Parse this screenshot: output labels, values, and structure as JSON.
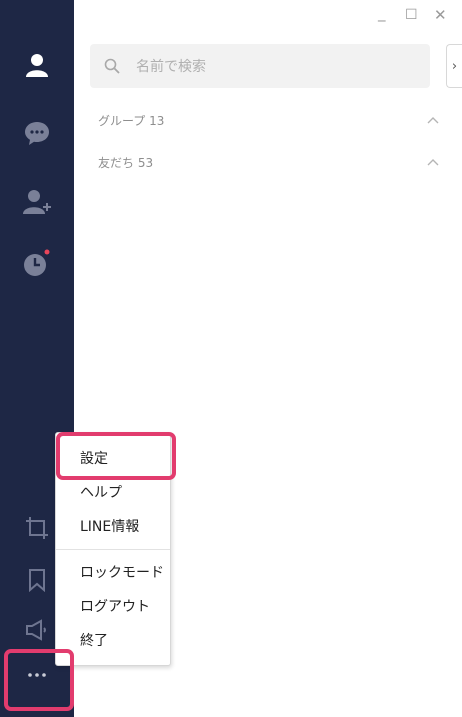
{
  "window": {
    "minimize_label": "_",
    "maximize_label": "☐",
    "close_label": "✕"
  },
  "search": {
    "placeholder": "名前で検索",
    "collapse_icon": "chevron-right"
  },
  "sections": [
    {
      "label": "グループ 13",
      "icon": "chevron-up"
    },
    {
      "label": "友だち 53",
      "icon": "chevron-up"
    }
  ],
  "sidebar": {
    "top_icons": [
      "person-icon",
      "chat-icon",
      "add-friend-icon",
      "clock-icon"
    ],
    "bottom_icons": [
      "crop-icon",
      "bookmark-icon",
      "megaphone-icon",
      "more-icon"
    ],
    "notification_color": "#e8455a"
  },
  "menu": {
    "items": [
      "設定",
      "ヘルプ",
      "LINE情報",
      "ロックモード",
      "ログアウト",
      "終了"
    ]
  },
  "colors": {
    "sidebar_bg": "#1e2745",
    "highlight": "#e23c6e"
  }
}
